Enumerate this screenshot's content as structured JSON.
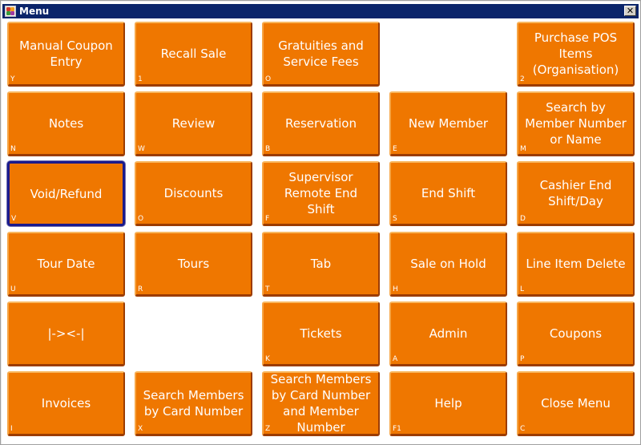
{
  "window": {
    "title": "Menu",
    "close_label": "✕"
  },
  "colors": {
    "button": "#ef7700",
    "titlebar": "#0a246a",
    "selected_border": "#1a1a8c"
  },
  "buttons": [
    {
      "label": "Manual Coupon\nEntry",
      "key": "Y",
      "row": 0,
      "col": 0
    },
    {
      "label": "Recall Sale",
      "key": "1",
      "row": 0,
      "col": 1
    },
    {
      "label": "Gratuities and\nService Fees",
      "key": "O",
      "row": 0,
      "col": 2
    },
    {
      "label": "Purchase POS\nItems\n(Organisation)",
      "key": "2",
      "row": 0,
      "col": 4
    },
    {
      "label": "Notes",
      "key": "N",
      "row": 1,
      "col": 0
    },
    {
      "label": "Review",
      "key": "W",
      "row": 1,
      "col": 1
    },
    {
      "label": "Reservation",
      "key": "B",
      "row": 1,
      "col": 2
    },
    {
      "label": "New Member",
      "key": "E",
      "row": 1,
      "col": 3
    },
    {
      "label": "Search by\nMember Number\nor Name",
      "key": "M",
      "row": 1,
      "col": 4
    },
    {
      "label": "Void/Refund",
      "key": "V",
      "row": 2,
      "col": 0,
      "selected": true
    },
    {
      "label": "Discounts",
      "key": "O",
      "row": 2,
      "col": 1
    },
    {
      "label": "Supervisor\nRemote End\nShift",
      "key": "F",
      "row": 2,
      "col": 2
    },
    {
      "label": "End Shift",
      "key": "S",
      "row": 2,
      "col": 3
    },
    {
      "label": "Cashier End\nShift/Day",
      "key": "D",
      "row": 2,
      "col": 4
    },
    {
      "label": "Tour Date",
      "key": "U",
      "row": 3,
      "col": 0
    },
    {
      "label": "Tours",
      "key": "R",
      "row": 3,
      "col": 1
    },
    {
      "label": "Tab",
      "key": "T",
      "row": 3,
      "col": 2
    },
    {
      "label": "Sale on Hold",
      "key": "H",
      "row": 3,
      "col": 3
    },
    {
      "label": "Line Item Delete",
      "key": "L",
      "row": 3,
      "col": 4
    },
    {
      "label": "|-><-|",
      "key": "",
      "row": 4,
      "col": 0
    },
    {
      "label": "Tickets",
      "key": "K",
      "row": 4,
      "col": 2
    },
    {
      "label": "Admin",
      "key": "A",
      "row": 4,
      "col": 3
    },
    {
      "label": "Coupons",
      "key": "P",
      "row": 4,
      "col": 4
    },
    {
      "label": "Invoices",
      "key": "I",
      "row": 5,
      "col": 0
    },
    {
      "label": "Search Members\nby Card Number",
      "key": "X",
      "row": 5,
      "col": 1
    },
    {
      "label": "Search Members\nby Card Number\nand Member\nNumber",
      "key": "Z",
      "row": 5,
      "col": 2
    },
    {
      "label": "Help",
      "key": "F1",
      "row": 5,
      "col": 3
    },
    {
      "label": "Close Menu",
      "key": "C",
      "row": 5,
      "col": 4
    }
  ]
}
